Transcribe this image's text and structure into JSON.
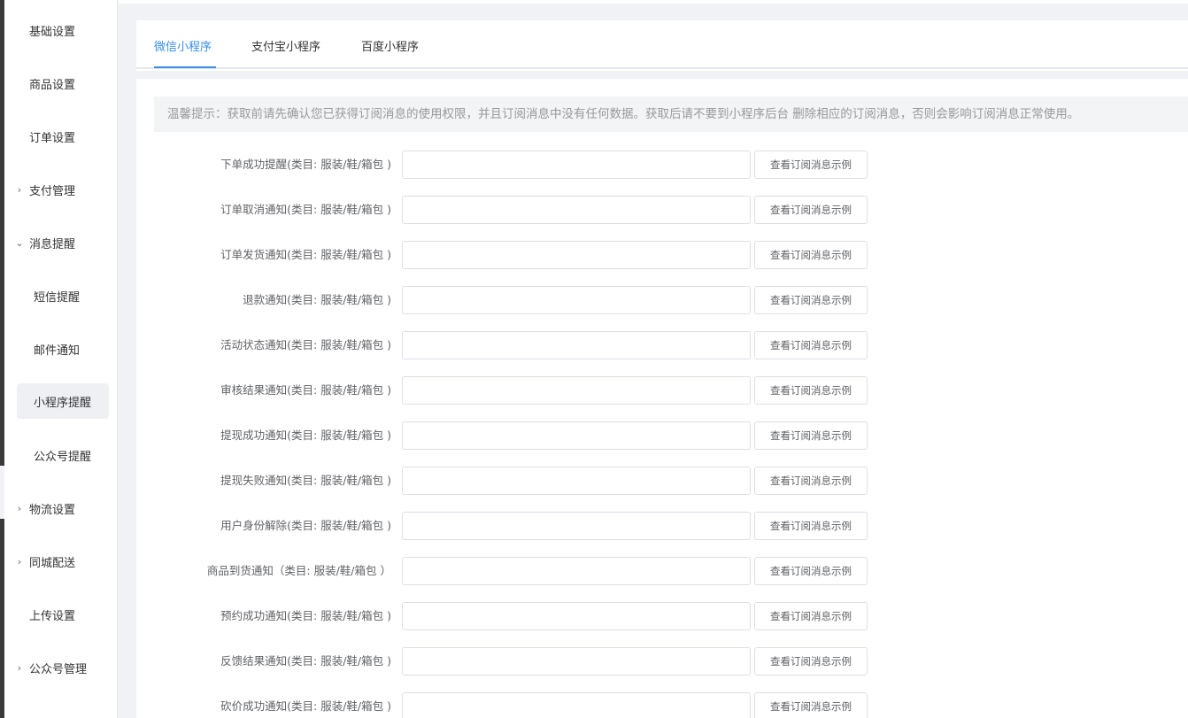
{
  "sidebar": {
    "items": [
      {
        "label": "基础设置",
        "arrow": ""
      },
      {
        "label": "商品设置",
        "arrow": ""
      },
      {
        "label": "订单设置",
        "arrow": ""
      },
      {
        "label": "支付管理",
        "arrow": "›"
      },
      {
        "label": "消息提醒",
        "arrow": "⌄"
      },
      {
        "label": "短信提醒",
        "arrow": ""
      },
      {
        "label": "邮件通知",
        "arrow": ""
      },
      {
        "label": "小程序提醒",
        "arrow": ""
      },
      {
        "label": "公众号提醒",
        "arrow": ""
      },
      {
        "label": "物流设置",
        "arrow": "›"
      },
      {
        "label": "同城配送",
        "arrow": "›"
      },
      {
        "label": "上传设置",
        "arrow": ""
      },
      {
        "label": "公众号管理",
        "arrow": "›"
      }
    ]
  },
  "tabs": [
    {
      "label": "微信小程序"
    },
    {
      "label": "支付宝小程序"
    },
    {
      "label": "百度小程序"
    }
  ],
  "notice": "温馨提示：获取前请先确认您已获得订阅消息的使用权限，并且订阅消息中没有任何数据。获取后请不要到小程序后台 删除相应的订阅消息，否则会影响订阅消息正常使用。",
  "button_label": "查看订阅消息示例",
  "rows": [
    {
      "label": "下单成功提醒(类目: 服装/鞋/箱包 )",
      "value": ""
    },
    {
      "label": "订单取消通知(类目: 服装/鞋/箱包 )",
      "value": ""
    },
    {
      "label": "订单发货通知(类目: 服装/鞋/箱包 )",
      "value": ""
    },
    {
      "label": "退款通知(类目: 服装/鞋/箱包 )",
      "value": ""
    },
    {
      "label": "活动状态通知(类目: 服装/鞋/箱包 )",
      "value": ""
    },
    {
      "label": "审核结果通知(类目: 服装/鞋/箱包 )",
      "value": ""
    },
    {
      "label": "提现成功通知(类目: 服装/鞋/箱包 )",
      "value": ""
    },
    {
      "label": "提现失败通知(类目: 服装/鞋/箱包 )",
      "value": ""
    },
    {
      "label": "用户身份解除(类目: 服装/鞋/箱包 )",
      "value": ""
    },
    {
      "label": "商品到货通知（类目: 服装/鞋/箱包 ）",
      "value": ""
    },
    {
      "label": "预约成功通知(类目: 服装/鞋/箱包 )",
      "value": ""
    },
    {
      "label": "反馈结果通知(类目: 服装/鞋/箱包 )",
      "value": ""
    },
    {
      "label": "砍价成功通知(类目: 服装/鞋/箱包 )",
      "value": ""
    }
  ],
  "colors": {
    "accent": "#3a8ee6",
    "notice_bg": "#f3f4f6"
  }
}
